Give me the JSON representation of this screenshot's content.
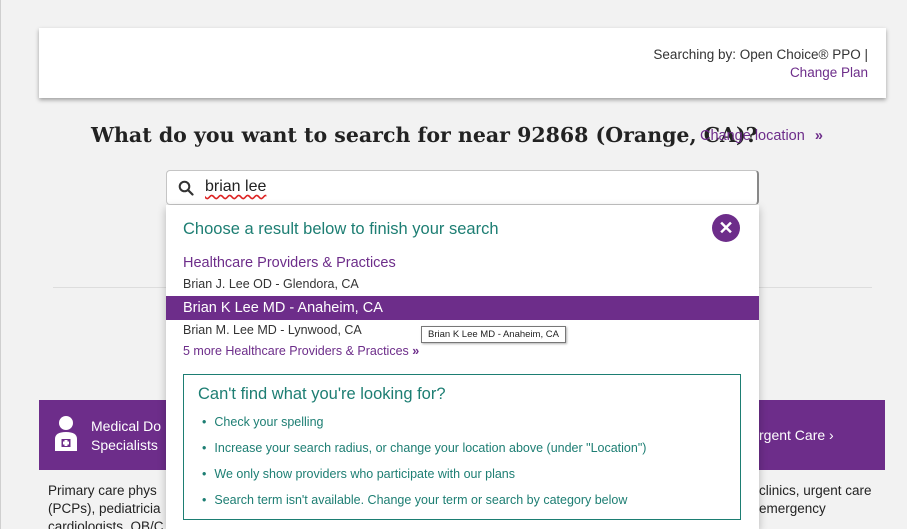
{
  "header": {
    "searching_by": "Searching by: Open Choice® PPO |",
    "change_plan": "Change Plan"
  },
  "question": "What do you want to search for near 92868 (Orange, CA)?",
  "change_location": {
    "label": "Change location",
    "chevron": "»"
  },
  "search": {
    "value": "brian lee",
    "icon": "search-icon"
  },
  "dropdown": {
    "heading": "Choose a result below to finish your search",
    "close_icon": "close-icon",
    "category": "Healthcare Providers & Practices",
    "items": [
      "Brian J. Lee OD - Glendora, CA",
      "Brian K Lee MD - Anaheim, CA",
      "Brian M. Lee MD - Lynwood, CA"
    ],
    "highlighted_index": 1,
    "more_link": "5 more Healthcare Providers & Practices",
    "more_chevron": "»",
    "tooltip": "Brian K Lee MD - Anaheim, CA"
  },
  "help": {
    "title": "Can't find what you're looking for?",
    "tips": [
      "Check your spelling",
      "Increase your search radius, or change your location above (under \"Location\")",
      "We only show providers who participate with our plans",
      "Search term isn't available. Change your term or search by category below"
    ]
  },
  "categories": {
    "left": {
      "line1": "Medical Do",
      "line2": "Specialists",
      "icon": "doctor-icon",
      "desc": [
        "Primary care phys",
        "(PCPs), pediatricia",
        "cardiologists, OB/C"
      ]
    },
    "right": {
      "label": "rgent Care ›",
      "desc": [
        "clinics, urgent care",
        "emergency"
      ]
    }
  },
  "colors": {
    "brand": "#6d2d8a",
    "accent": "#1d7e73"
  }
}
